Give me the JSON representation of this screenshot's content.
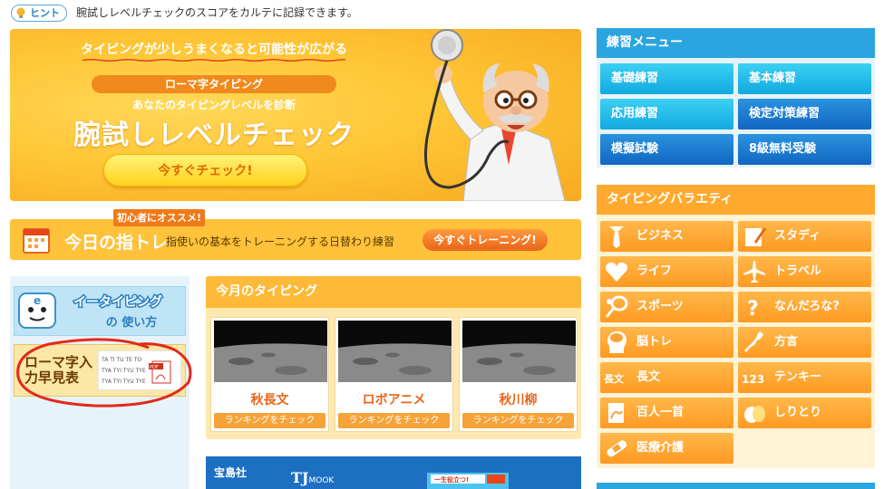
{
  "hint": {
    "badge": "ヒント",
    "text": "腕試しレベルチェックのスコアをカルテに記録できます。"
  },
  "hero": {
    "tagline": "タイピングが少しうまくなると可能性が広がる",
    "pill": "ローマ字タイピング",
    "sub": "あなたのタイピングレベルを診断",
    "title": "腕試しレベルチェック",
    "button": "今すぐチェック!"
  },
  "daily": {
    "tag": "初心者にオススメ!",
    "title": "今日の指トレ",
    "desc": "指使いの基本をトレーニングする日替わり練習",
    "button": "今すぐトレーニング!"
  },
  "left": {
    "etyping_line1": "イータイピング",
    "etyping_line2": "の 使い方",
    "romaji_title": "ローマ字入力早見表",
    "pdf": "PDF",
    "sheet_rows": [
      "TA TI TU TE TO",
      "TYA TYI TYU TYE",
      "TYA TYI TYU TYE"
    ]
  },
  "monthly": {
    "header": "今月のタイピング",
    "cards": [
      {
        "name": "秋長文",
        "button": "ランキングをチェック"
      },
      {
        "name": "ロボアニメ",
        "button": "ランキングをチェック"
      },
      {
        "name": "秋川柳",
        "button": "ランキングをチェック"
      }
    ]
  },
  "tjmook": {
    "publisher": "宝島社",
    "brand": "TJ",
    "brand_small": "MOOK",
    "book": "一生役立つ!"
  },
  "practice_menu": {
    "header": "練習メニュー",
    "items": [
      "基礎練習",
      "基本練習",
      "応用練習",
      "検定対策練習",
      "模擬試験",
      "8級無料受験"
    ]
  },
  "variety": {
    "header": "タイピングバラエティ",
    "items": [
      {
        "label": "ビジネス",
        "icon": "necktie-icon"
      },
      {
        "label": "スタディ",
        "icon": "pencil-notebook-icon"
      },
      {
        "label": "ライフ",
        "icon": "heart-icon"
      },
      {
        "label": "トラベル",
        "icon": "airplane-icon"
      },
      {
        "label": "スポーツ",
        "icon": "racket-icon"
      },
      {
        "label": "なんだろな?",
        "icon": "question-icon"
      },
      {
        "label": "脳トレ",
        "icon": "head-icon"
      },
      {
        "label": "方言",
        "icon": "japan-map-icon"
      },
      {
        "label": "長文",
        "icon": "long-text-icon"
      },
      {
        "label": "テンキー",
        "icon": "numbers-icon"
      },
      {
        "label": "百人一首",
        "icon": "poem-card-icon"
      },
      {
        "label": "しりとり",
        "icon": "fruit-icon"
      },
      {
        "label": "医療介護",
        "icon": "bandage-icon"
      }
    ],
    "long_text_icon_glyph": "長文",
    "numbers_icon_glyph": "123"
  },
  "colors": {
    "accent_orange": "#ffa92e",
    "accent_blue": "#2ba5df",
    "hero_yellow": "#ffc636"
  }
}
